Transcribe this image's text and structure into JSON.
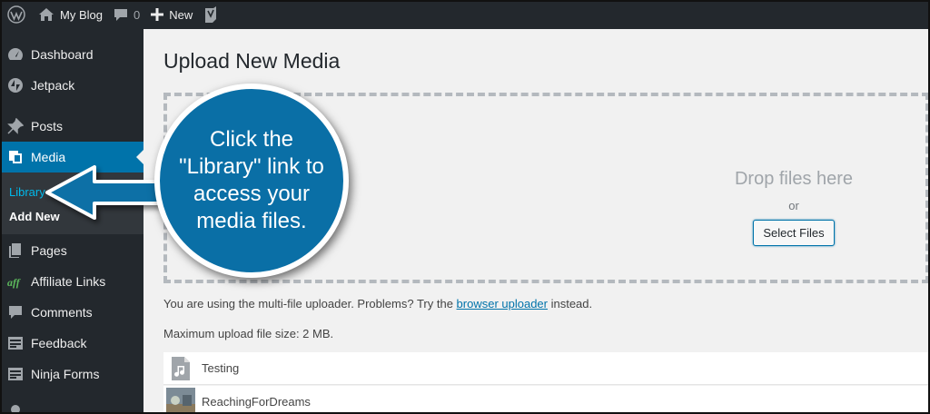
{
  "adminbar": {
    "site_name": "My Blog",
    "comments_count": "0",
    "new_label": "New"
  },
  "sidebar": {
    "items": [
      {
        "label": "Dashboard",
        "icon": "dashboard-icon"
      },
      {
        "label": "Jetpack",
        "icon": "jetpack-icon"
      },
      {
        "label": "Posts",
        "icon": "pin-icon"
      },
      {
        "label": "Media",
        "icon": "media-icon"
      },
      {
        "label": "Pages",
        "icon": "pages-icon"
      },
      {
        "label": "Affiliate Links",
        "icon": "aff-icon"
      },
      {
        "label": "Comments",
        "icon": "comment-icon"
      },
      {
        "label": "Feedback",
        "icon": "feedback-icon"
      },
      {
        "label": "Ninja Forms",
        "icon": "forms-icon"
      }
    ],
    "submenu": {
      "library": "Library",
      "add_new": "Add New"
    }
  },
  "main": {
    "title": "Upload New Media",
    "drop_text": "Drop files here",
    "or_text": "or",
    "select_button": "Select Files",
    "info_prefix": "You are using the multi-file uploader. Problems? Try the ",
    "info_link": "browser uploader",
    "info_suffix": " instead.",
    "max_size": "Maximum upload file size: 2 MB.",
    "files": [
      {
        "name": "Testing",
        "icon": "audio-file-icon"
      },
      {
        "name": "ReachingForDreams",
        "icon": "image-thumbnail"
      }
    ]
  },
  "callout": {
    "text": "Click the \"Library\" link to access your media files."
  },
  "colors": {
    "accent": "#0073aa",
    "sidebar_bg": "#23282d",
    "callout_bg": "#0a6fa6"
  }
}
